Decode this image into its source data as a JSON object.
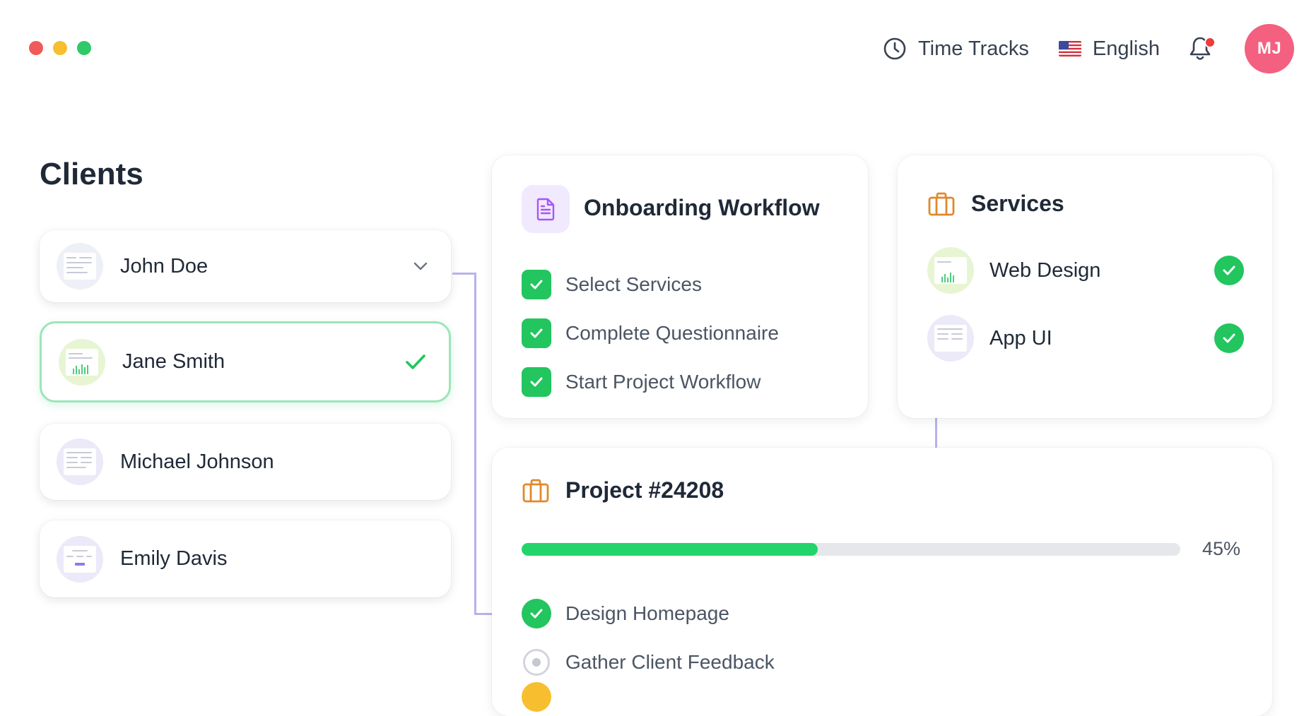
{
  "window": {
    "controls": [
      "close",
      "minimize",
      "maximize"
    ]
  },
  "topbar": {
    "time_tracks_label": "Time Tracks",
    "language_label": "English",
    "avatar_initials": "MJ",
    "notification_indicator": true,
    "icons": [
      "clock-icon",
      "us-flag-icon",
      "bell-icon"
    ]
  },
  "clients": {
    "title": "Clients",
    "items": [
      {
        "name": "John Doe",
        "state": "collapsed"
      },
      {
        "name": "Jane Smith",
        "state": "selected"
      },
      {
        "name": "Michael Johnson",
        "state": "default"
      },
      {
        "name": "Emily Davis",
        "state": "default"
      }
    ]
  },
  "onboarding": {
    "title": "Onboarding Workflow",
    "tasks": [
      {
        "label": "Select Services",
        "done": true
      },
      {
        "label": "Complete Questionnaire",
        "done": true
      },
      {
        "label": "Start Project Workflow",
        "done": true
      }
    ]
  },
  "services": {
    "title": "Services",
    "items": [
      {
        "name": "Web Design",
        "selected": true
      },
      {
        "name": "App UI",
        "selected": true
      }
    ]
  },
  "project": {
    "title": "Project #24208",
    "progress": 0.45,
    "progress_label": "45%",
    "tasks": [
      {
        "label": "Design Homepage",
        "status": "done"
      },
      {
        "label": "Gather Client Feedback",
        "status": "pending"
      }
    ]
  },
  "colors": {
    "accent_green": "#22c55e",
    "avatar": "#f4607f",
    "connector": "#b7b2ec",
    "icon_orange": "#e0892c",
    "icon_purple": "#a855f7",
    "selected_border": "#9be6b8"
  }
}
